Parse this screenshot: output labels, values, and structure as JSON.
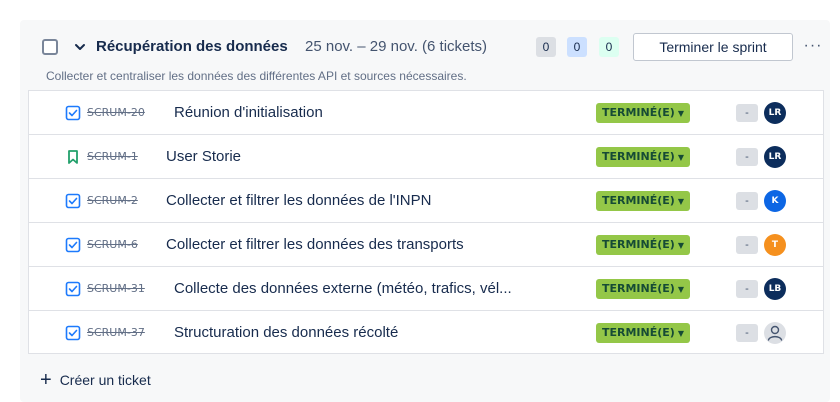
{
  "sprint": {
    "title": "Récupération des données",
    "dates": "25 nov. – 29 nov. (6 tickets)",
    "description": "Collecter et centraliser les données des différentes API et sources nécessaires.",
    "counts": {
      "todo": "0",
      "in_progress": "0",
      "done": "0"
    },
    "finish_label": "Terminer le sprint",
    "more_label": "···"
  },
  "colors": {
    "status_done_bg": "#94c748",
    "task_icon": "#1d7afc",
    "story_icon": "#22a06b"
  },
  "tickets": [
    {
      "type_icon": "task-icon",
      "key": "SCRUM-20",
      "title": "Réunion d'initialisation",
      "status": "TERMINÉ(E)",
      "estimate": "-",
      "assignee_initials": "LR",
      "assignee_color": "#0c2d5c"
    },
    {
      "type_icon": "story-icon",
      "key": "SCRUM-1",
      "title": "User Storie",
      "status": "TERMINÉ(E)",
      "estimate": "-",
      "assignee_initials": "LR",
      "assignee_color": "#0c2d5c"
    },
    {
      "type_icon": "task-icon",
      "key": "SCRUM-2",
      "title": "Collecter et filtrer les données de l'INPN",
      "status": "TERMINÉ(E)",
      "estimate": "-",
      "assignee_initials": "K",
      "assignee_color": "#0c66e4"
    },
    {
      "type_icon": "task-icon",
      "key": "SCRUM-6",
      "title": "Collecter et filtrer les données des transports",
      "status": "TERMINÉ(E)",
      "estimate": "-",
      "assignee_initials": "T",
      "assignee_color": "#f5901e"
    },
    {
      "type_icon": "task-icon",
      "key": "SCRUM-31",
      "title": "Collecte des données externe (météo, trafics, vél...",
      "status": "TERMINÉ(E)",
      "estimate": "-",
      "assignee_initials": "LB",
      "assignee_color": "#0c2d5c"
    },
    {
      "type_icon": "task-icon",
      "key": "SCRUM-37",
      "title": "Structuration des données récolté",
      "status": "TERMINÉ(E)",
      "estimate": "-",
      "assignee_initials": "",
      "assignee_color": "#dcdfe4"
    }
  ],
  "create_label": "Créer un ticket"
}
